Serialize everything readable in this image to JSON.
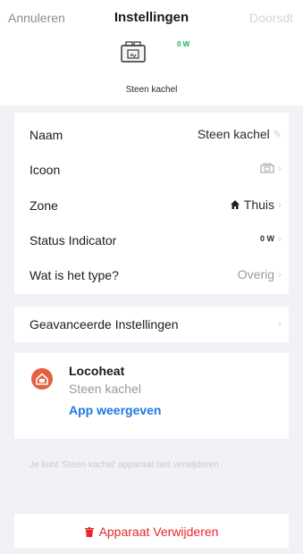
{
  "header": {
    "cancel_label": "Annuleren",
    "title": "Instellingen",
    "done_label": "Doorsdt",
    "device_power": "0 W",
    "device_name": "Steen kachel"
  },
  "settings": {
    "name_label": "Naam",
    "name_value": "Steen kachel",
    "icon_label": "Icoon",
    "zone_label": "Zone",
    "zone_value": "Thuis",
    "status_label": "Status Indicator",
    "status_value": "0 W",
    "type_label": "Wat is het type?",
    "type_value": "Overig"
  },
  "advanced": {
    "label": "Geavanceerde Instellingen"
  },
  "brand": {
    "name": "Locoheat",
    "device": "Steen kachel",
    "link_label": "App weergeven"
  },
  "note": "Je kunt 'Steen kachel' apparaat niet verwijderen",
  "delete_label": "Apparaat Verwijderen",
  "colors": {
    "accent_blue": "#1f78e6",
    "danger_red": "#e8262a",
    "power_green": "#1bb24f",
    "brand_orange": "#e4603f"
  }
}
